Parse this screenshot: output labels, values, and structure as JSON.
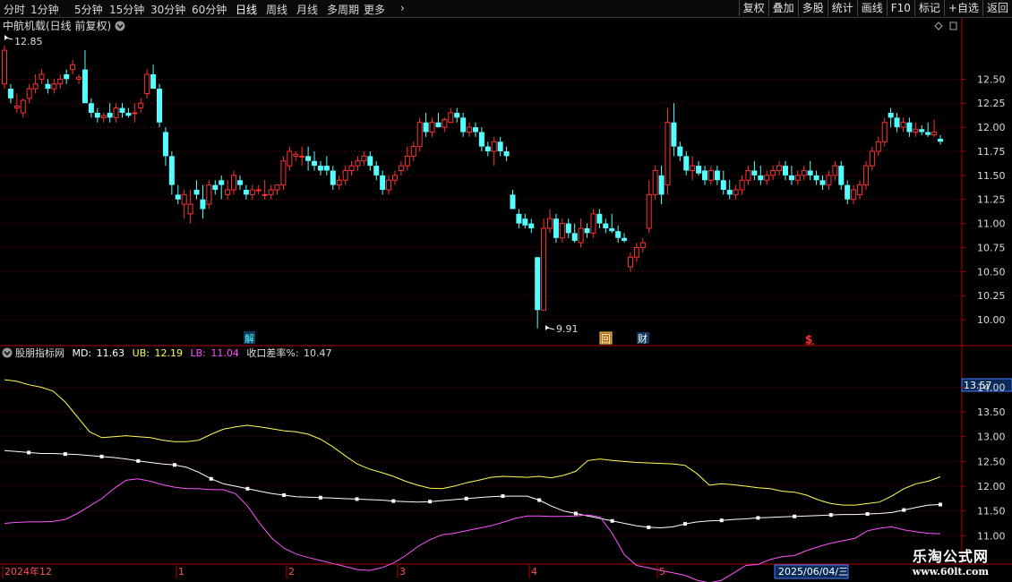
{
  "toolbar": {
    "timeframes": [
      "分时",
      "1分钟",
      "5分钟",
      "15分钟",
      "30分钟",
      "60分钟",
      "日线",
      "周线",
      "月线",
      "多周期",
      "更多"
    ],
    "active_index": 6,
    "right_buttons": [
      "复权",
      "叠加",
      "多股",
      "统计",
      "画线",
      "F10",
      "标记",
      "+自选",
      "返回"
    ]
  },
  "colors": {
    "up": "#ff3232",
    "down": "#54ffff",
    "md": "#ffffff",
    "ub": "#ffff54",
    "lb": "#ff54ff",
    "grid": "#7a0000",
    "axis": "#b40000",
    "label": "#dcdcdc"
  },
  "main_panel": {
    "title": "中航机载(日线 前复权)",
    "y_ticks": [
      "12.50",
      "12.25",
      "12.00",
      "11.75",
      "11.50",
      "11.25",
      "11.00",
      "10.75",
      "10.50",
      "10.25",
      "10.00"
    ],
    "high_marker": "12.85",
    "low_marker": "9.91",
    "event_labels": [
      "解",
      "回",
      "财",
      "$"
    ]
  },
  "indicator_panel": {
    "name": "股朋指标网",
    "md_label": "MD:",
    "md_value": "11.63",
    "ub_label": "UB:",
    "ub_value": "12.19",
    "lb_label": "LB:",
    "lb_value": "11.04",
    "rate_label": "收口差率%:",
    "rate_value": "10.47",
    "y_ticks": [
      "14.00",
      "13.50",
      "13.00",
      "12.50",
      "12.00",
      "11.50",
      "11.00"
    ],
    "current_value": "13.57"
  },
  "date_axis": {
    "labels": [
      "2024年12",
      "1",
      "2",
      "3",
      "4",
      "5"
    ],
    "cursor_date": "2025/06/04/三"
  },
  "watermark": {
    "line1": "乐淘公式网",
    "line2": "www.60lt.com"
  },
  "chart_data": [
    {
      "type": "candlestick",
      "title": "中航机载(日线 前复权)",
      "ylim": [
        9.88,
        12.95
      ],
      "candles_ohlc": [
        [
          12.45,
          12.85,
          12.4,
          12.8
        ],
        [
          12.4,
          12.45,
          12.25,
          12.3
        ],
        [
          12.2,
          12.35,
          12.15,
          12.22
        ],
        [
          12.15,
          12.3,
          12.1,
          12.28
        ],
        [
          12.3,
          12.45,
          12.25,
          12.4
        ],
        [
          12.4,
          12.55,
          12.35,
          12.45
        ],
        [
          12.5,
          12.6,
          12.45,
          12.55
        ],
        [
          12.45,
          12.5,
          12.35,
          12.4
        ],
        [
          12.4,
          12.5,
          12.35,
          12.45
        ],
        [
          12.45,
          12.55,
          12.4,
          12.5
        ],
        [
          12.55,
          12.6,
          12.45,
          12.5
        ],
        [
          12.6,
          12.7,
          12.55,
          12.65
        ],
        [
          12.5,
          12.55,
          12.45,
          12.52
        ],
        [
          12.6,
          12.8,
          12.4,
          12.25
        ],
        [
          12.25,
          12.3,
          12.1,
          12.15
        ],
        [
          12.15,
          12.2,
          12.05,
          12.1
        ],
        [
          12.1,
          12.15,
          12.05,
          12.12
        ],
        [
          12.15,
          12.25,
          12.05,
          12.1
        ],
        [
          12.1,
          12.25,
          12.05,
          12.2
        ],
        [
          12.2,
          12.25,
          12.1,
          12.15
        ],
        [
          12.15,
          12.2,
          12.1,
          12.12
        ],
        [
          12.15,
          12.25,
          12.05,
          12.15
        ],
        [
          12.2,
          12.3,
          12.15,
          12.25
        ],
        [
          12.35,
          12.6,
          12.3,
          12.55
        ],
        [
          12.55,
          12.65,
          12.5,
          12.4
        ],
        [
          12.4,
          12.45,
          12.0,
          12.05
        ],
        [
          11.95,
          12.0,
          11.6,
          11.7
        ],
        [
          11.7,
          11.75,
          11.3,
          11.4
        ],
        [
          11.3,
          11.4,
          11.2,
          11.25
        ],
        [
          11.2,
          11.35,
          11.05,
          11.3
        ],
        [
          11.1,
          11.35,
          11.0,
          11.2
        ],
        [
          11.35,
          11.45,
          11.25,
          11.3
        ],
        [
          11.25,
          11.4,
          11.05,
          11.15
        ],
        [
          11.2,
          11.45,
          11.15,
          11.4
        ],
        [
          11.4,
          11.45,
          11.3,
          11.35
        ],
        [
          11.45,
          11.5,
          11.25,
          11.4
        ],
        [
          11.3,
          11.45,
          11.25,
          11.35
        ],
        [
          11.35,
          11.55,
          11.3,
          11.5
        ],
        [
          11.45,
          11.5,
          11.35,
          11.4
        ],
        [
          11.35,
          11.4,
          11.25,
          11.3
        ],
        [
          11.3,
          11.4,
          11.25,
          11.35
        ],
        [
          11.35,
          11.4,
          11.3,
          11.35
        ],
        [
          11.3,
          11.45,
          11.25,
          11.3
        ],
        [
          11.3,
          11.4,
          11.25,
          11.35
        ],
        [
          11.35,
          11.4,
          11.3,
          11.4
        ],
        [
          11.4,
          11.7,
          11.35,
          11.65
        ],
        [
          11.6,
          11.8,
          11.55,
          11.75
        ],
        [
          11.7,
          11.75,
          11.65,
          11.72
        ],
        [
          11.7,
          11.8,
          11.6,
          11.7
        ],
        [
          11.7,
          11.8,
          11.55,
          11.65
        ],
        [
          11.65,
          11.75,
          11.55,
          11.6
        ],
        [
          11.6,
          11.65,
          11.5,
          11.55
        ],
        [
          11.6,
          11.7,
          11.5,
          11.55
        ],
        [
          11.55,
          11.6,
          11.35,
          11.4
        ],
        [
          11.4,
          11.5,
          11.35,
          11.45
        ],
        [
          11.45,
          11.6,
          11.4,
          11.55
        ],
        [
          11.55,
          11.65,
          11.5,
          11.6
        ],
        [
          11.6,
          11.7,
          11.55,
          11.65
        ],
        [
          11.65,
          11.75,
          11.6,
          11.7
        ],
        [
          11.7,
          11.75,
          11.55,
          11.6
        ],
        [
          11.6,
          11.65,
          11.45,
          11.5
        ],
        [
          11.5,
          11.55,
          11.3,
          11.35
        ],
        [
          11.35,
          11.5,
          11.3,
          11.45
        ],
        [
          11.45,
          11.55,
          11.4,
          11.5
        ],
        [
          11.55,
          11.65,
          11.5,
          11.6
        ],
        [
          11.6,
          11.8,
          11.55,
          11.7
        ],
        [
          11.7,
          11.85,
          11.65,
          11.8
        ],
        [
          11.8,
          12.1,
          11.75,
          12.05
        ],
        [
          12.05,
          12.15,
          11.9,
          11.95
        ],
        [
          11.95,
          12.1,
          11.9,
          12.05
        ],
        [
          12.05,
          12.15,
          12.0,
          12.0
        ],
        [
          12.0,
          12.1,
          11.95,
          12.08
        ],
        [
          12.05,
          12.2,
          12.05,
          12.15
        ],
        [
          12.15,
          12.2,
          12.05,
          12.1
        ],
        [
          12.1,
          12.15,
          11.9,
          11.95
        ],
        [
          11.95,
          12.05,
          11.9,
          12.0
        ],
        [
          12.0,
          12.05,
          11.9,
          11.95
        ],
        [
          11.95,
          12.0,
          11.75,
          11.8
        ],
        [
          11.8,
          11.85,
          11.7,
          11.75
        ],
        [
          11.75,
          11.9,
          11.6,
          11.85
        ],
        [
          11.85,
          11.9,
          11.7,
          11.75
        ],
        [
          11.75,
          11.8,
          11.65,
          11.7
        ],
        [
          11.3,
          11.35,
          11.15,
          11.15
        ],
        [
          11.1,
          11.15,
          10.95,
          11.0
        ],
        [
          11.05,
          11.1,
          10.95,
          10.98
        ],
        [
          11.0,
          11.05,
          10.9,
          10.95
        ],
        [
          10.65,
          10.65,
          9.91,
          10.1
        ],
        [
          10.1,
          11.05,
          10.1,
          10.95
        ],
        [
          10.95,
          11.15,
          10.9,
          11.05
        ],
        [
          11.05,
          11.1,
          10.8,
          10.85
        ],
        [
          10.85,
          11.05,
          10.8,
          11.0
        ],
        [
          11.0,
          11.05,
          10.85,
          10.9
        ],
        [
          10.9,
          11.0,
          10.8,
          10.82
        ],
        [
          10.8,
          11.05,
          10.75,
          10.95
        ],
        [
          10.95,
          11.0,
          10.85,
          10.9
        ],
        [
          10.9,
          11.15,
          10.85,
          11.1
        ],
        [
          11.1,
          11.15,
          10.95,
          11.0
        ],
        [
          11.0,
          11.05,
          10.9,
          10.95
        ],
        [
          10.95,
          11.1,
          10.9,
          10.92
        ],
        [
          10.92,
          10.98,
          10.8,
          10.85
        ],
        [
          10.85,
          10.9,
          10.8,
          10.82
        ],
        [
          10.55,
          10.7,
          10.5,
          10.65
        ],
        [
          10.65,
          10.8,
          10.6,
          10.75
        ],
        [
          10.75,
          10.85,
          10.7,
          10.8
        ],
        [
          10.95,
          11.45,
          10.9,
          11.3
        ],
        [
          11.3,
          11.6,
          11.25,
          11.55
        ],
        [
          11.5,
          11.6,
          11.2,
          11.3
        ],
        [
          11.4,
          12.2,
          11.3,
          12.05
        ],
        [
          12.05,
          12.25,
          11.7,
          11.8
        ],
        [
          11.8,
          11.85,
          11.65,
          11.7
        ],
        [
          11.7,
          11.75,
          11.5,
          11.55
        ],
        [
          11.55,
          11.7,
          11.45,
          11.6
        ],
        [
          11.6,
          11.65,
          11.5,
          11.52
        ],
        [
          11.55,
          11.6,
          11.4,
          11.45
        ],
        [
          11.45,
          11.6,
          11.4,
          11.55
        ],
        [
          11.55,
          11.6,
          11.4,
          11.45
        ],
        [
          11.45,
          11.55,
          11.3,
          11.35
        ],
        [
          11.35,
          11.45,
          11.25,
          11.3
        ],
        [
          11.3,
          11.4,
          11.25,
          11.35
        ],
        [
          11.35,
          11.5,
          11.3,
          11.45
        ],
        [
          11.45,
          11.6,
          11.4,
          11.55
        ],
        [
          11.55,
          11.65,
          11.45,
          11.5
        ],
        [
          11.5,
          11.6,
          11.4,
          11.45
        ],
        [
          11.45,
          11.55,
          11.4,
          11.5
        ],
        [
          11.5,
          11.6,
          11.45,
          11.55
        ],
        [
          11.55,
          11.65,
          11.5,
          11.6
        ],
        [
          11.6,
          11.65,
          11.45,
          11.5
        ],
        [
          11.5,
          11.6,
          11.4,
          11.45
        ],
        [
          11.45,
          11.55,
          11.4,
          11.5
        ],
        [
          11.5,
          11.6,
          11.45,
          11.55
        ],
        [
          11.55,
          11.65,
          11.45,
          11.5
        ],
        [
          11.5,
          11.55,
          11.4,
          11.45
        ],
        [
          11.45,
          11.5,
          11.35,
          11.4
        ],
        [
          11.4,
          11.55,
          11.35,
          11.5
        ],
        [
          11.5,
          11.65,
          11.45,
          11.6
        ],
        [
          11.6,
          11.65,
          11.35,
          11.4
        ],
        [
          11.4,
          11.45,
          11.2,
          11.25
        ],
        [
          11.25,
          11.4,
          11.2,
          11.35
        ],
        [
          11.3,
          11.45,
          11.25,
          11.4
        ],
        [
          11.4,
          11.65,
          11.35,
          11.6
        ],
        [
          11.6,
          11.8,
          11.55,
          11.75
        ],
        [
          11.75,
          11.9,
          11.7,
          11.85
        ],
        [
          11.85,
          12.1,
          11.8,
          12.05
        ],
        [
          12.15,
          12.2,
          12.0,
          12.1
        ],
        [
          12.1,
          12.15,
          11.95,
          12.0
        ],
        [
          12.0,
          12.1,
          11.95,
          12.05
        ],
        [
          12.05,
          12.1,
          11.9,
          11.95
        ],
        [
          11.95,
          12.05,
          11.9,
          11.98
        ],
        [
          11.98,
          12.02,
          11.92,
          11.95
        ],
        [
          11.95,
          12.05,
          11.9,
          11.92
        ],
        [
          11.92,
          12.08,
          11.9,
          11.95
        ],
        [
          11.88,
          11.92,
          11.82,
          11.85
        ]
      ]
    },
    {
      "type": "line",
      "title": "股朋指标网",
      "ylim": [
        10.5,
        14.55
      ],
      "series": [
        {
          "name": "UB",
          "values": [
            14.15,
            14.12,
            14.05,
            14.0,
            13.92,
            13.7,
            13.4,
            13.1,
            12.98,
            13.0,
            13.02,
            13.0,
            12.98,
            12.93,
            12.9,
            12.9,
            12.93,
            13.05,
            13.15,
            13.2,
            13.23,
            13.2,
            13.16,
            13.12,
            13.1,
            13.05,
            12.95,
            12.8,
            12.62,
            12.45,
            12.35,
            12.28,
            12.2,
            12.1,
            12.02,
            11.96,
            11.95,
            12.0,
            12.07,
            12.12,
            12.18,
            12.2,
            12.19,
            12.18,
            12.2,
            12.17,
            12.22,
            12.3,
            12.52,
            12.55,
            12.52,
            12.5,
            12.48,
            12.47,
            12.46,
            12.45,
            12.42,
            12.25,
            12.02,
            12.05,
            12.03,
            12.0,
            11.97,
            11.95,
            11.9,
            11.88,
            11.82,
            11.72,
            11.65,
            11.62,
            11.62,
            11.65,
            11.68,
            11.8,
            11.95,
            12.05,
            12.1,
            12.19
          ]
        },
        {
          "name": "MD",
          "values": [
            12.72,
            12.7,
            12.68,
            12.66,
            12.66,
            12.65,
            12.64,
            12.62,
            12.6,
            12.58,
            12.55,
            12.51,
            12.48,
            12.45,
            12.43,
            12.38,
            12.28,
            12.15,
            12.05,
            12.0,
            11.95,
            11.9,
            11.85,
            11.82,
            11.79,
            11.78,
            11.77,
            11.76,
            11.75,
            11.74,
            11.73,
            11.72,
            11.7,
            11.69,
            11.68,
            11.69,
            11.71,
            11.73,
            11.75,
            11.77,
            11.79,
            11.8,
            11.8,
            11.8,
            11.72,
            11.6,
            11.5,
            11.45,
            11.4,
            11.35,
            11.3,
            11.25,
            11.2,
            11.17,
            11.16,
            11.18,
            11.24,
            11.28,
            11.3,
            11.31,
            11.33,
            11.34,
            11.36,
            11.37,
            11.38,
            11.39,
            11.4,
            11.41,
            11.42,
            11.43,
            11.43,
            11.44,
            11.45,
            11.47,
            11.52,
            11.57,
            11.62,
            11.63
          ]
        },
        {
          "name": "LB",
          "values": [
            11.25,
            11.27,
            11.28,
            11.28,
            11.29,
            11.33,
            11.45,
            11.6,
            11.75,
            11.95,
            12.12,
            12.15,
            12.1,
            12.03,
            11.98,
            11.95,
            11.95,
            11.93,
            11.93,
            11.85,
            11.6,
            11.25,
            10.95,
            10.75,
            10.63,
            10.56,
            10.5,
            10.44,
            10.38,
            10.32,
            10.3,
            10.35,
            10.45,
            10.6,
            10.78,
            10.92,
            11.02,
            11.05,
            11.1,
            11.15,
            11.2,
            11.27,
            11.35,
            11.4,
            11.4,
            11.39,
            11.39,
            11.4,
            11.42,
            11.38,
            11.05,
            10.62,
            10.4,
            10.35,
            10.3,
            10.25,
            10.2,
            10.1,
            10.05,
            10.1,
            10.25,
            10.4,
            10.42,
            10.52,
            10.58,
            10.6,
            10.7,
            10.78,
            10.85,
            10.9,
            10.95,
            11.1,
            11.15,
            11.18,
            11.12,
            11.08,
            11.05,
            11.04
          ]
        }
      ]
    }
  ]
}
